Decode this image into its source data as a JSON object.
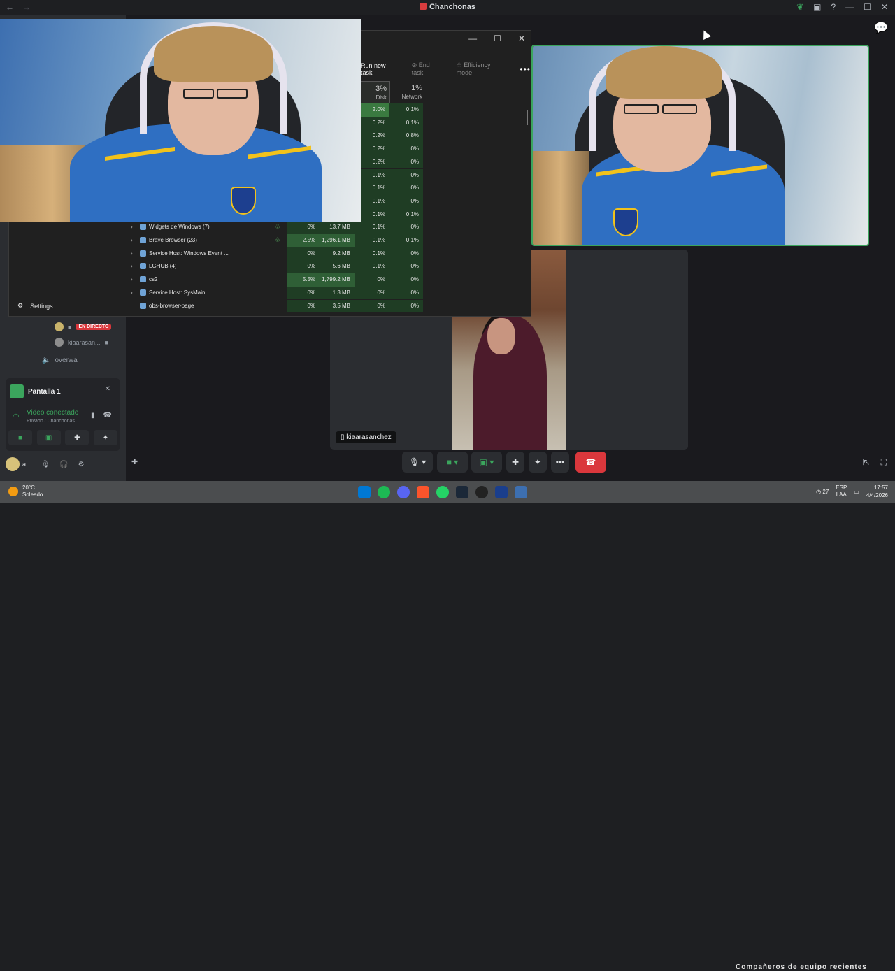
{
  "window": {
    "title": "Chanchonas",
    "nav_back": "←",
    "nav_forward": "→",
    "controls": [
      "—",
      "☐",
      "✕"
    ]
  },
  "task_manager": {
    "window_controls": [
      "—",
      "☐",
      "✕"
    ],
    "toolbar": {
      "run_new_task": "Run new task",
      "end_task": "End task",
      "efficiency_mode": "Efficiency mode",
      "more": "•••"
    },
    "headers": {
      "disk_pct": "3%",
      "disk_label": "Disk",
      "network_pct": "1%",
      "network_label": "Network"
    },
    "top_rows": [
      {
        "disk": "2.0%",
        "net": "0.1%"
      },
      {
        "disk": "0.2%",
        "net": "0.1%"
      },
      {
        "disk": "0.2%",
        "net": "0.8%"
      },
      {
        "disk": "0.2%",
        "net": "0%"
      },
      {
        "disk": "0.2%",
        "net": "0%"
      },
      {
        "disk": "0.1%",
        "net": "0%"
      },
      {
        "disk": "0.1%",
        "net": "0%"
      },
      {
        "disk": "0.1%",
        "net": "0%"
      },
      {
        "disk": "0.1%",
        "net": "0.1%"
      }
    ],
    "processes": [
      {
        "name": "Widgets de Windows (7)",
        "cpu": "0%",
        "mem": "13.7 MB",
        "disk": "0.1%",
        "net": "0%",
        "eff": true
      },
      {
        "name": "Brave Browser (23)",
        "cpu": "2.5%",
        "mem": "1,296.1 MB",
        "disk": "0.1%",
        "net": "0.1%",
        "eff": true
      },
      {
        "name": "Service Host: Windows Event ...",
        "cpu": "0%",
        "mem": "9.2 MB",
        "disk": "0.1%",
        "net": "0%",
        "eff": false
      },
      {
        "name": "LGHUB (4)",
        "cpu": "0%",
        "mem": "5.6 MB",
        "disk": "0.1%",
        "net": "0%",
        "eff": false
      },
      {
        "name": "cs2",
        "cpu": "5.5%",
        "mem": "1,799.2 MB",
        "disk": "0%",
        "net": "0%",
        "eff": false
      },
      {
        "name": "Service Host: SysMain",
        "cpu": "0%",
        "mem": "1.3 MB",
        "disk": "0%",
        "net": "0%",
        "eff": false
      },
      {
        "name": "obs-browser-page",
        "cpu": "0%",
        "mem": "3.5 MB",
        "disk": "0%",
        "net": "0%",
        "eff": false
      }
    ],
    "settings": "Settings"
  },
  "voice": {
    "live_badge": "EN DIRECTO",
    "member": "kiaarasan...",
    "channel": "overwa"
  },
  "share_panel": {
    "title": "Pantalla 1",
    "status": "Video conectado",
    "subtitle": "Privado / Chanchonas"
  },
  "user_panel": {
    "name": "a..."
  },
  "stage": {
    "participant_name": "kiaarasanchez"
  },
  "taskbar": {
    "temp": "20°C",
    "weather": "Soleado",
    "lang": "ESP",
    "region": "LAA",
    "time": "17:57",
    "date": "4/4/2026",
    "calendar_day": "27",
    "overlay": "Compañeros de equipo recientes"
  },
  "colors": {
    "accent_green": "#3ba55d",
    "danger_red": "#da373c",
    "live_red": "#da373c"
  }
}
